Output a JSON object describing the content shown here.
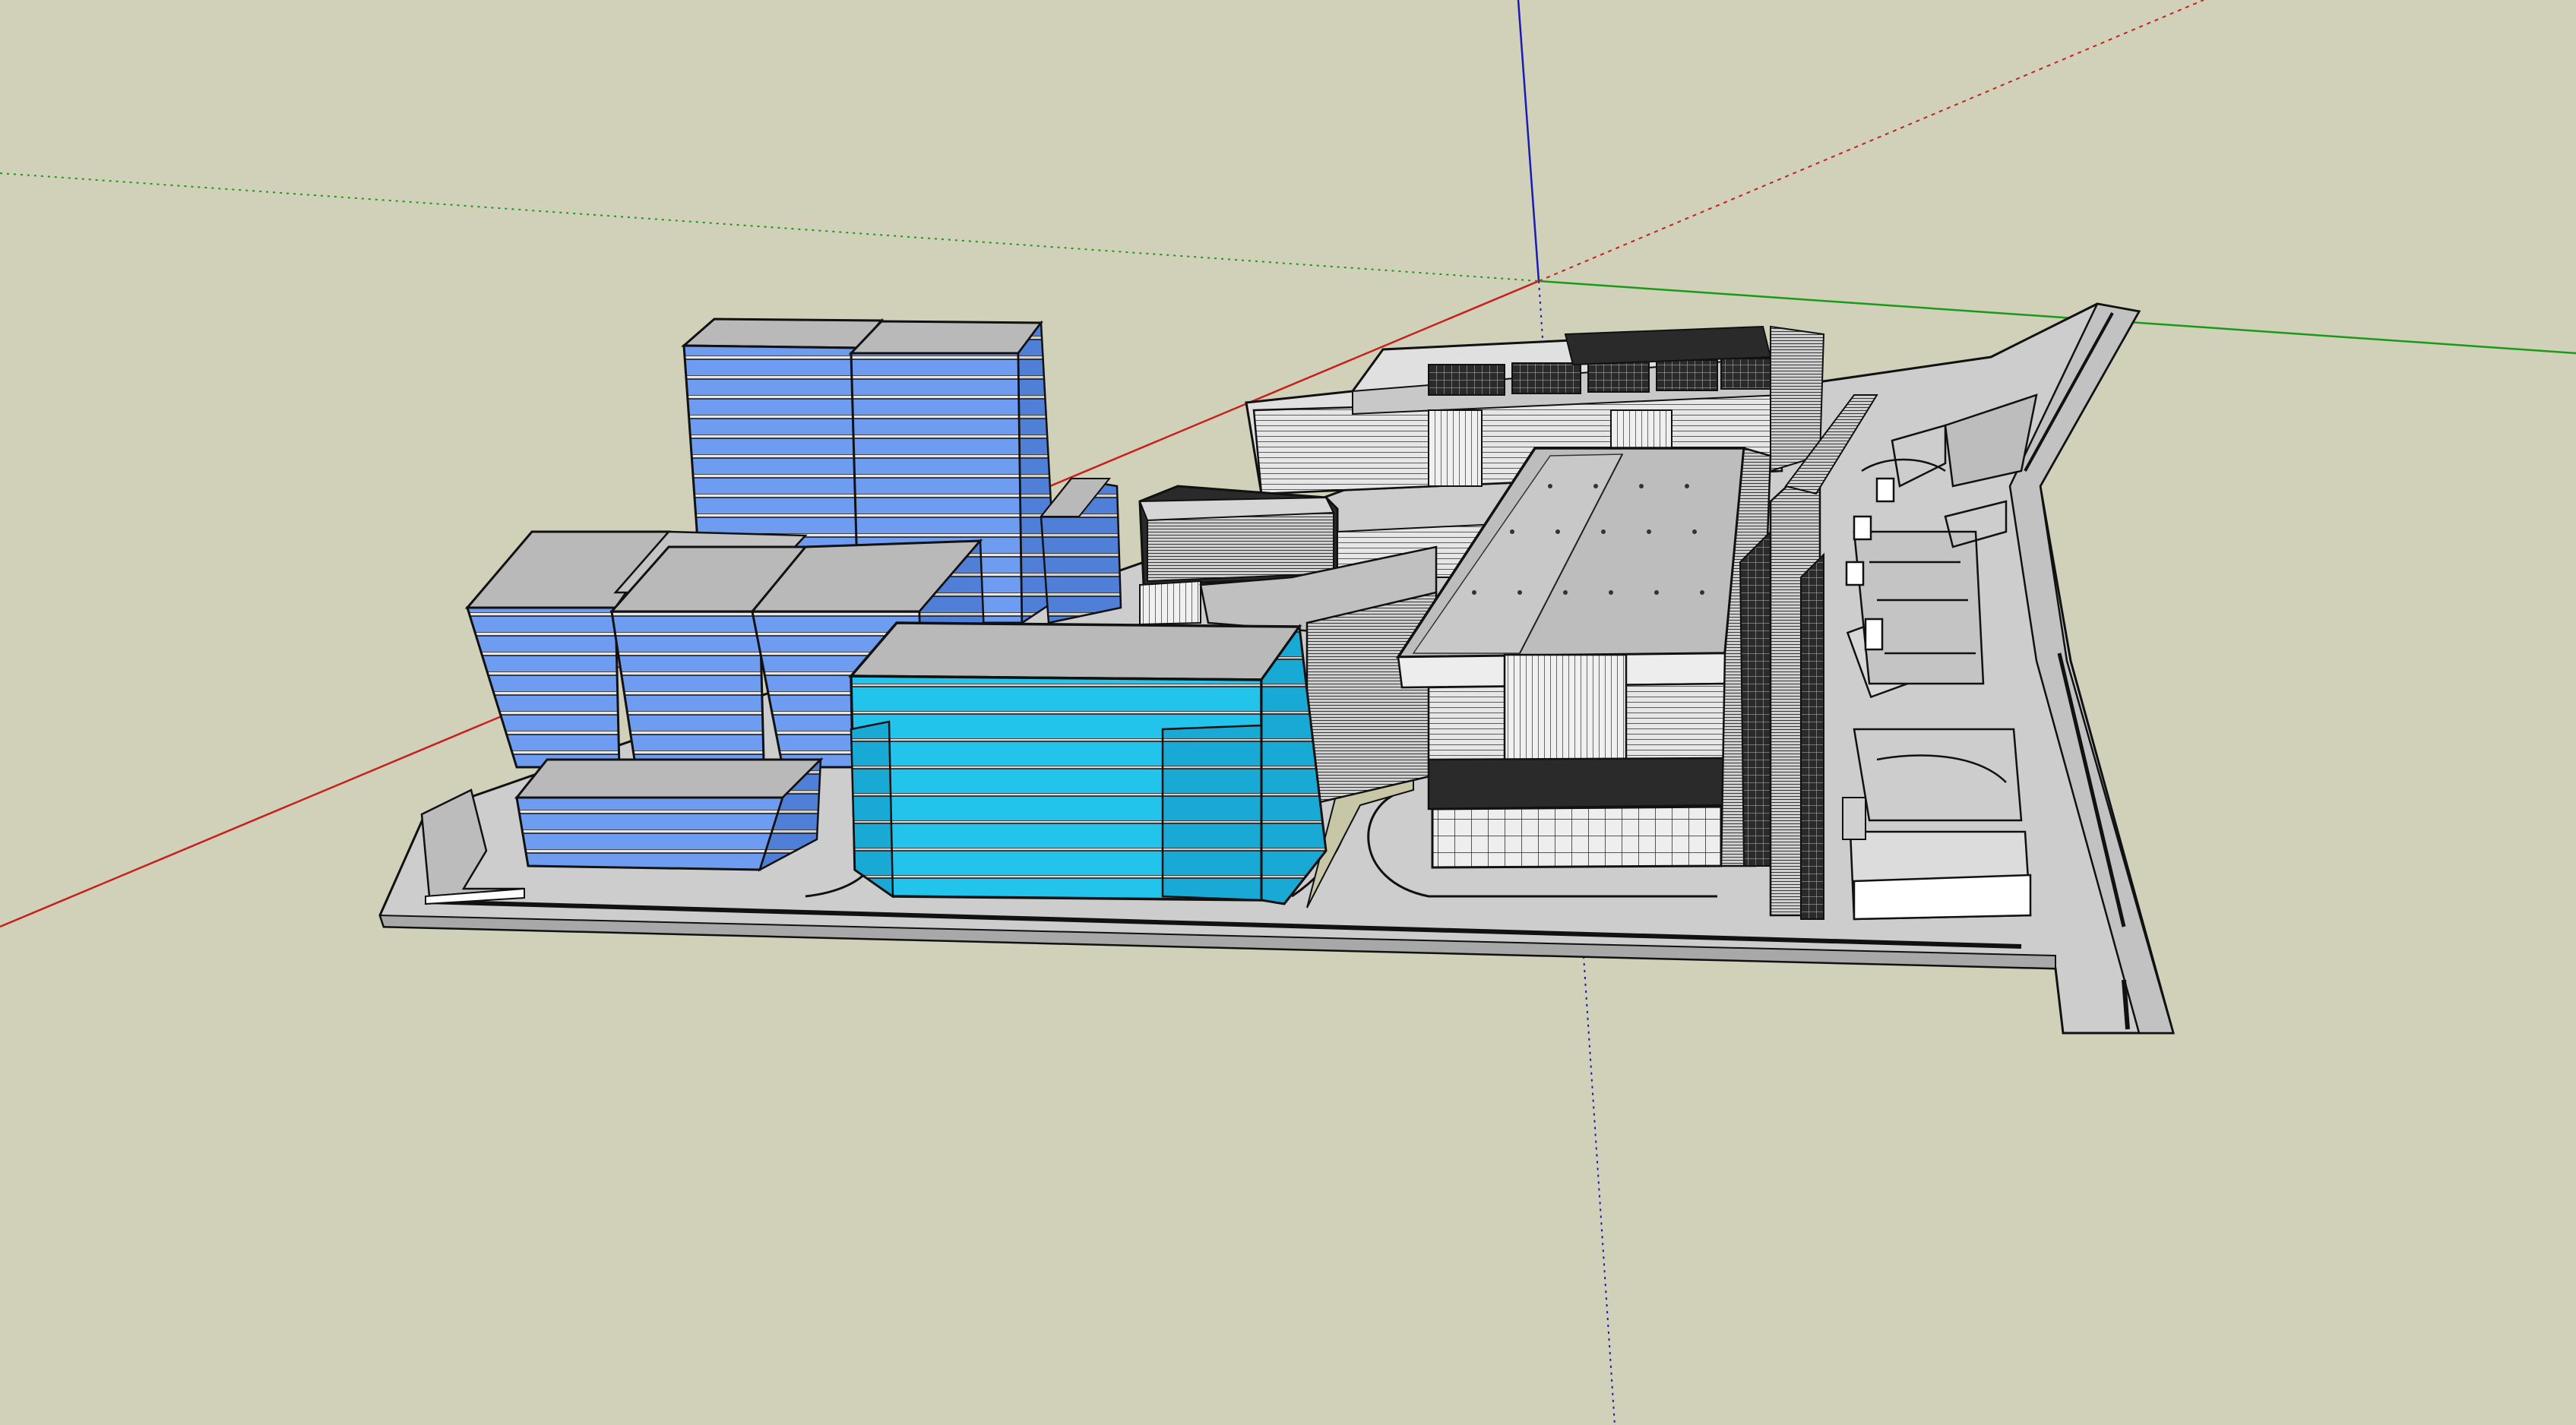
{
  "app": {
    "type": "3d-modeling-viewport"
  },
  "viewport": {
    "background_color": "#d1d0b8",
    "axis_colors": {
      "x_axis": "#c8201c",
      "y_axis": "#1a9a1a",
      "z_axis": "#1a1ab4"
    }
  },
  "scene": {
    "model_type": "urban-building-complex",
    "highlight_colors": {
      "selected_building": "#1fbfe8",
      "blue_towers": "#5a8fe6",
      "roof": "#b9b9b9",
      "ground_plane": "#cdcdcd"
    }
  }
}
